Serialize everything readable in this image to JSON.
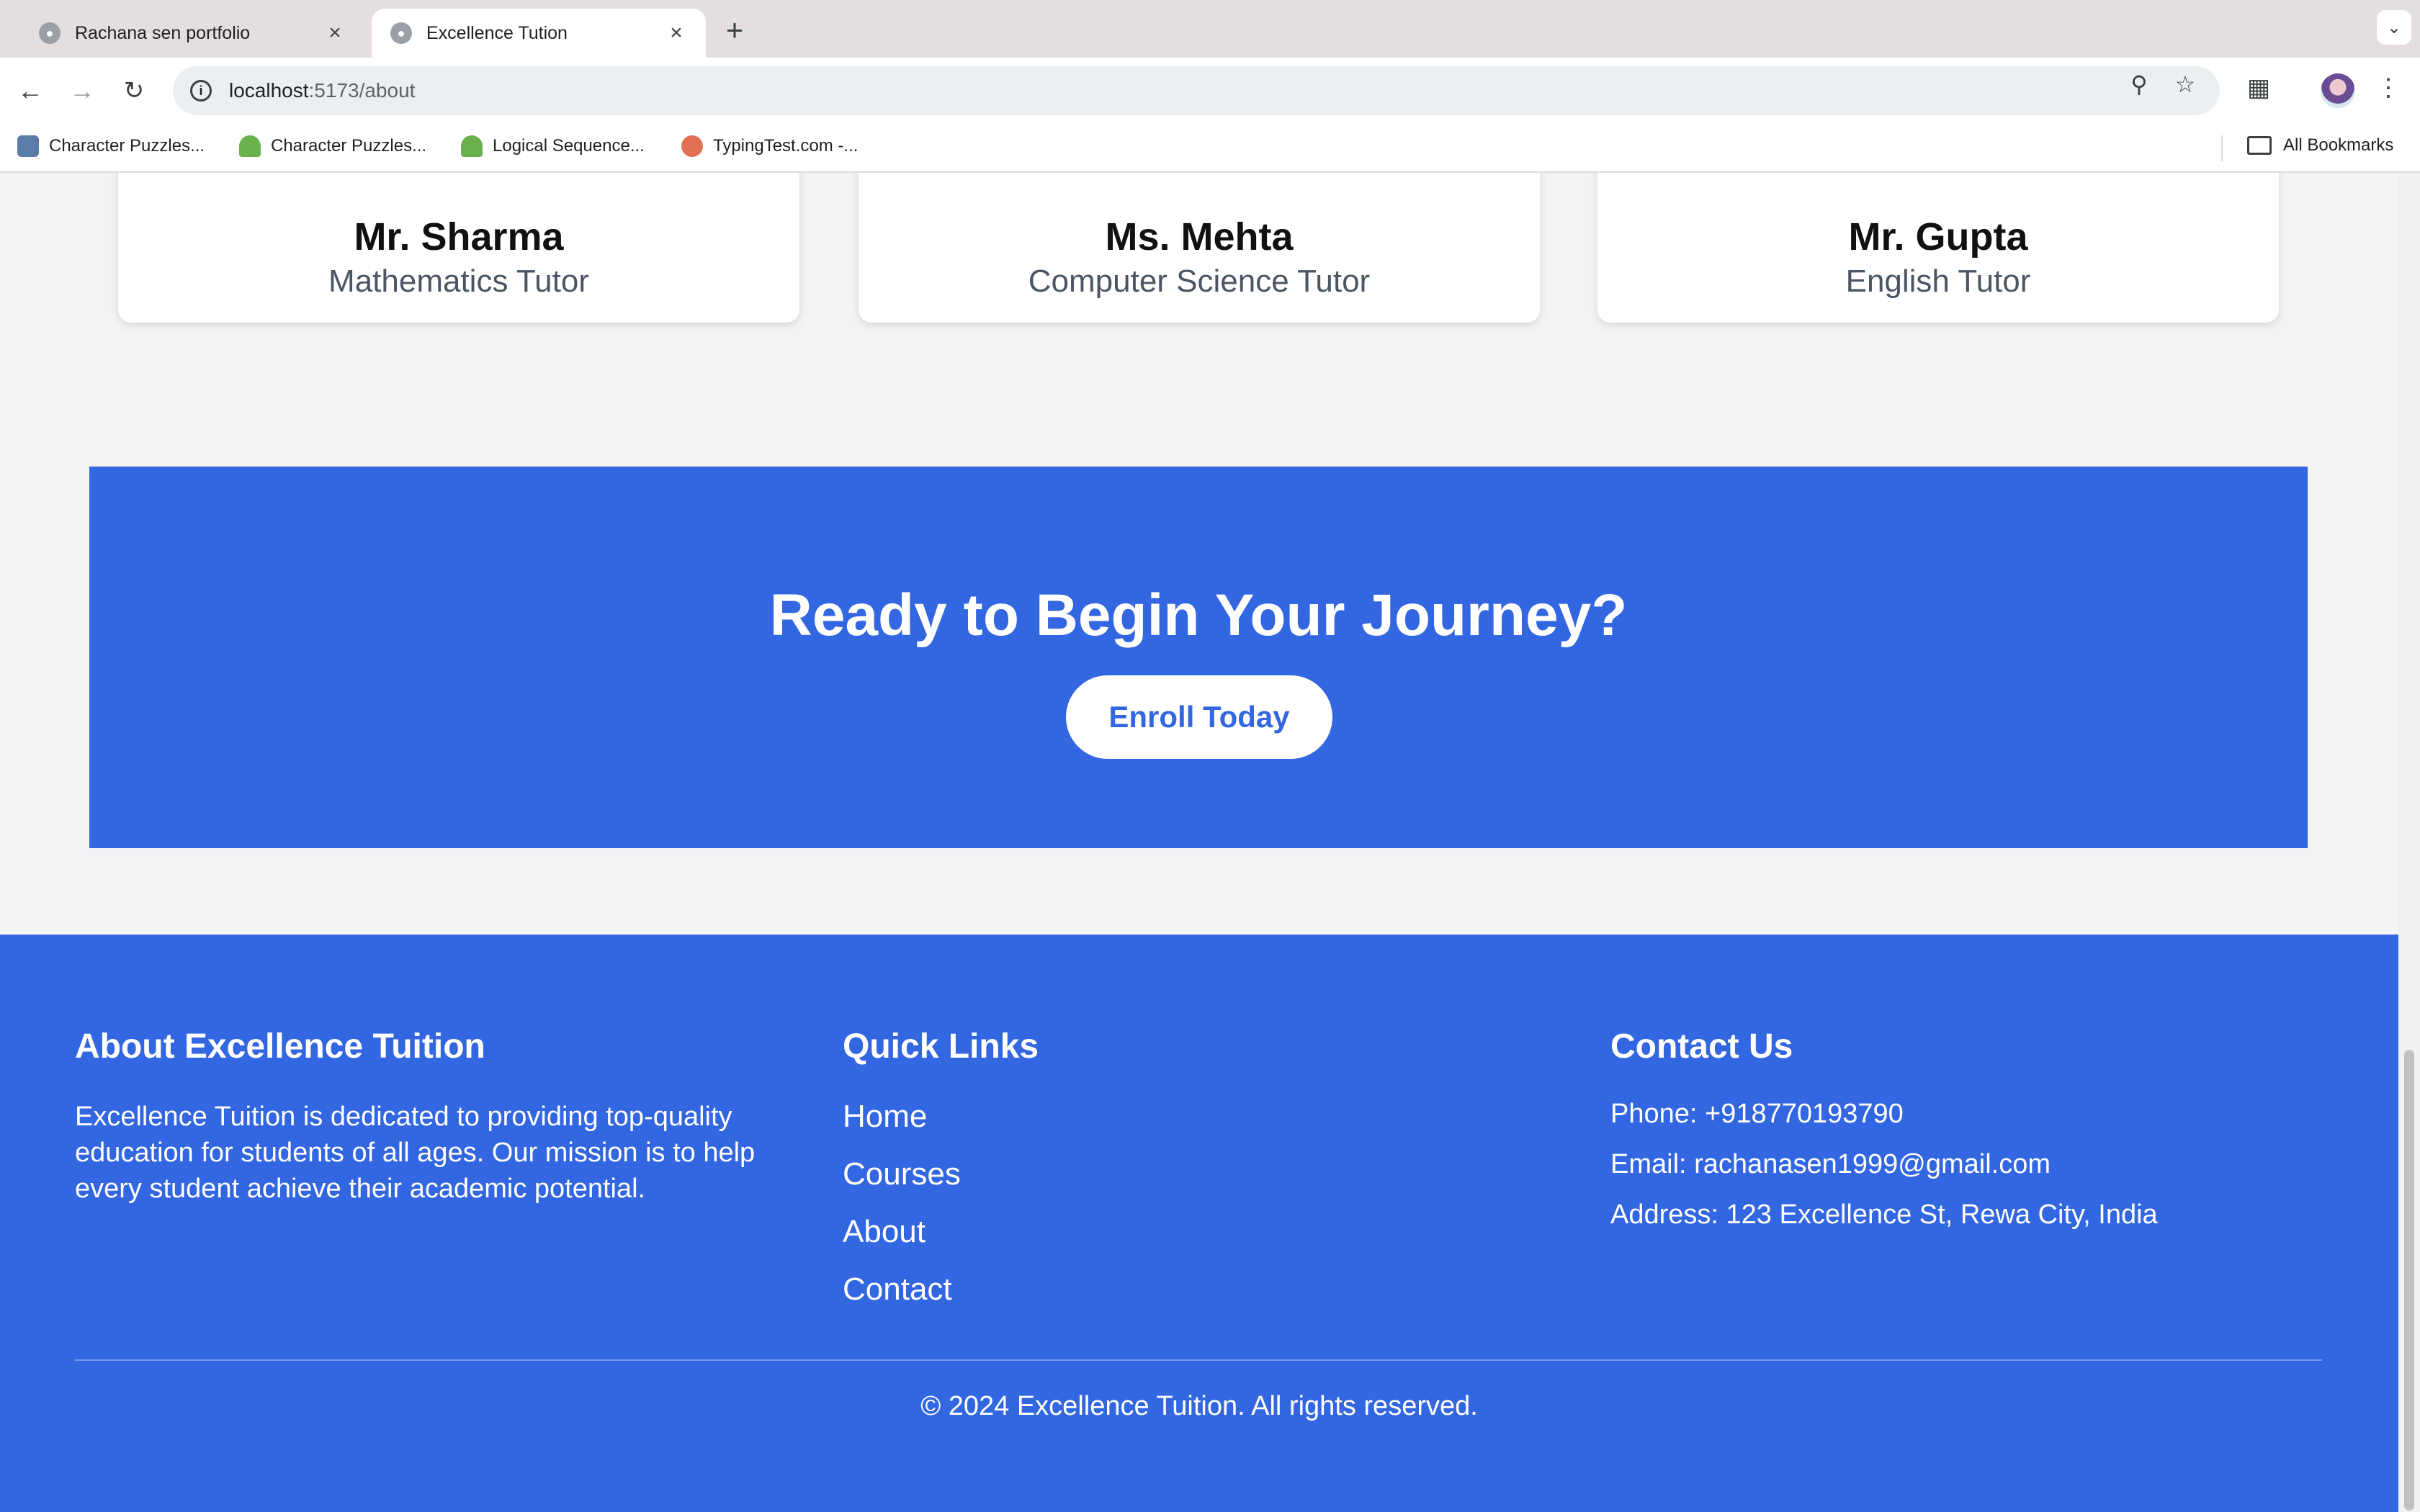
{
  "browser": {
    "tabs": [
      {
        "title": "Rachana sen portfolio",
        "active": false
      },
      {
        "title": "Excellence Tution",
        "active": true
      }
    ],
    "address": {
      "host": "localhost",
      "path": ":5173/about"
    },
    "bookmarks": [
      {
        "label": "Character Puzzles..."
      },
      {
        "label": "Character Puzzles..."
      },
      {
        "label": "Logical Sequence..."
      },
      {
        "label": "TypingTest.com -..."
      }
    ],
    "all_bookmarks_label": "All Bookmarks"
  },
  "tutors": [
    {
      "name": "Mr. Sharma",
      "subject": "Mathematics Tutor"
    },
    {
      "name": "Ms. Mehta",
      "subject": "Computer Science Tutor"
    },
    {
      "name": "Mr. Gupta",
      "subject": "English Tutor"
    }
  ],
  "cta": {
    "title": "Ready to Begin Your Journey?",
    "button": "Enroll Today"
  },
  "footer": {
    "about": {
      "heading": "About Excellence Tuition",
      "text": "Excellence Tuition is dedicated to providing top-quality education for students of all ages. Our mission is to help every student achieve their academic potential."
    },
    "quick_links": {
      "heading": "Quick Links",
      "links": [
        "Home",
        "Courses",
        "About",
        "Contact"
      ]
    },
    "contact": {
      "heading": "Contact Us",
      "phone": "Phone: +918770193790",
      "email": "Email: rachanasen1999@gmail.com",
      "address": "Address: 123 Excellence St, Rewa City, India"
    },
    "copyright": "© 2024 Excellence Tuition. All rights reserved."
  },
  "colors": {
    "brand_blue": "#3366e1",
    "page_bg": "#f3f4f6"
  }
}
